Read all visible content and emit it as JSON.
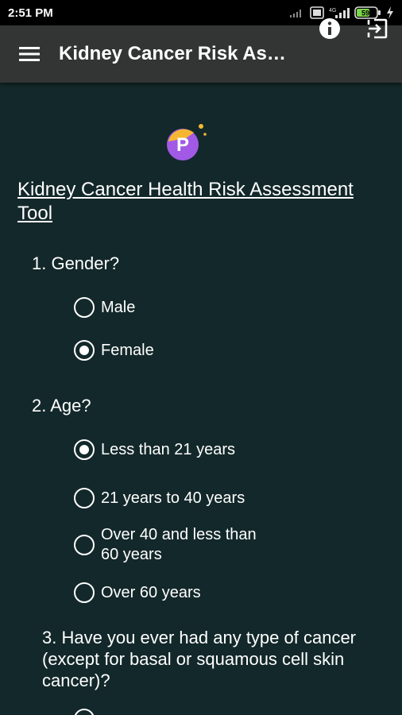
{
  "status_bar": {
    "time": "2:51 PM",
    "battery": "59"
  },
  "app_bar": {
    "title": "Kidney Cancer Risk Ass..."
  },
  "page": {
    "title": "Kidney Cancer Health Risk Assessment Tool",
    "logo_letter": "P"
  },
  "questions": [
    {
      "text": "1. Gender?",
      "options": [
        {
          "label": "Male",
          "selected": false
        },
        {
          "label": "Female",
          "selected": true
        }
      ]
    },
    {
      "text": "2. Age?",
      "options": [
        {
          "label": "Less than 21 years",
          "selected": true
        },
        {
          "label": "21 years to 40 years",
          "selected": false
        },
        {
          "label": "Over 40 and less than 60 years",
          "selected": false
        },
        {
          "label": "Over 60 years",
          "selected": false
        }
      ]
    },
    {
      "text": "3. Have you ever had any type of cancer (except for basal or squamous cell skin cancer)?",
      "options": []
    }
  ],
  "colors": {
    "background": "#13282a",
    "app_bar": "#333535",
    "status_bar": "#000000",
    "text": "#ffffff",
    "logo_primary": "#a259e6",
    "logo_accent": "#f5b731"
  }
}
